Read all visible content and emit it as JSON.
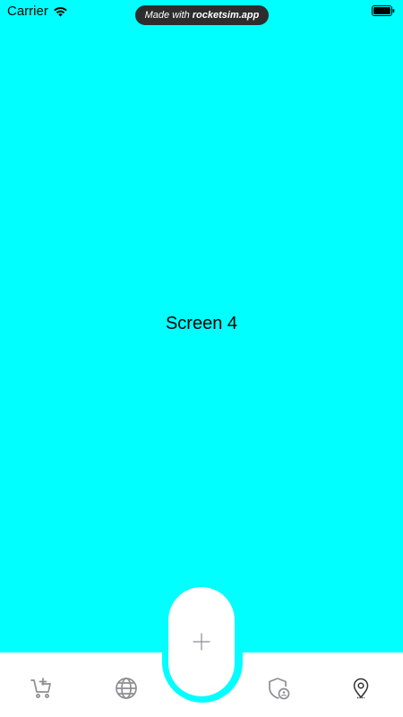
{
  "status_bar": {
    "carrier": "Carrier",
    "watermark_prefix": "Made with",
    "watermark_brand": "rocketsim.app"
  },
  "content": {
    "screen_label": "Screen 4",
    "background_color": "#00ffff"
  },
  "tab_bar": {
    "items": [
      {
        "icon": "cart-add-icon"
      },
      {
        "icon": "globe-icon"
      },
      {
        "icon": "plus-icon"
      },
      {
        "icon": "shield-user-icon"
      },
      {
        "icon": "location-pin-icon"
      }
    ],
    "inactive_color": "#8e8e93",
    "active_color": "#333333"
  }
}
